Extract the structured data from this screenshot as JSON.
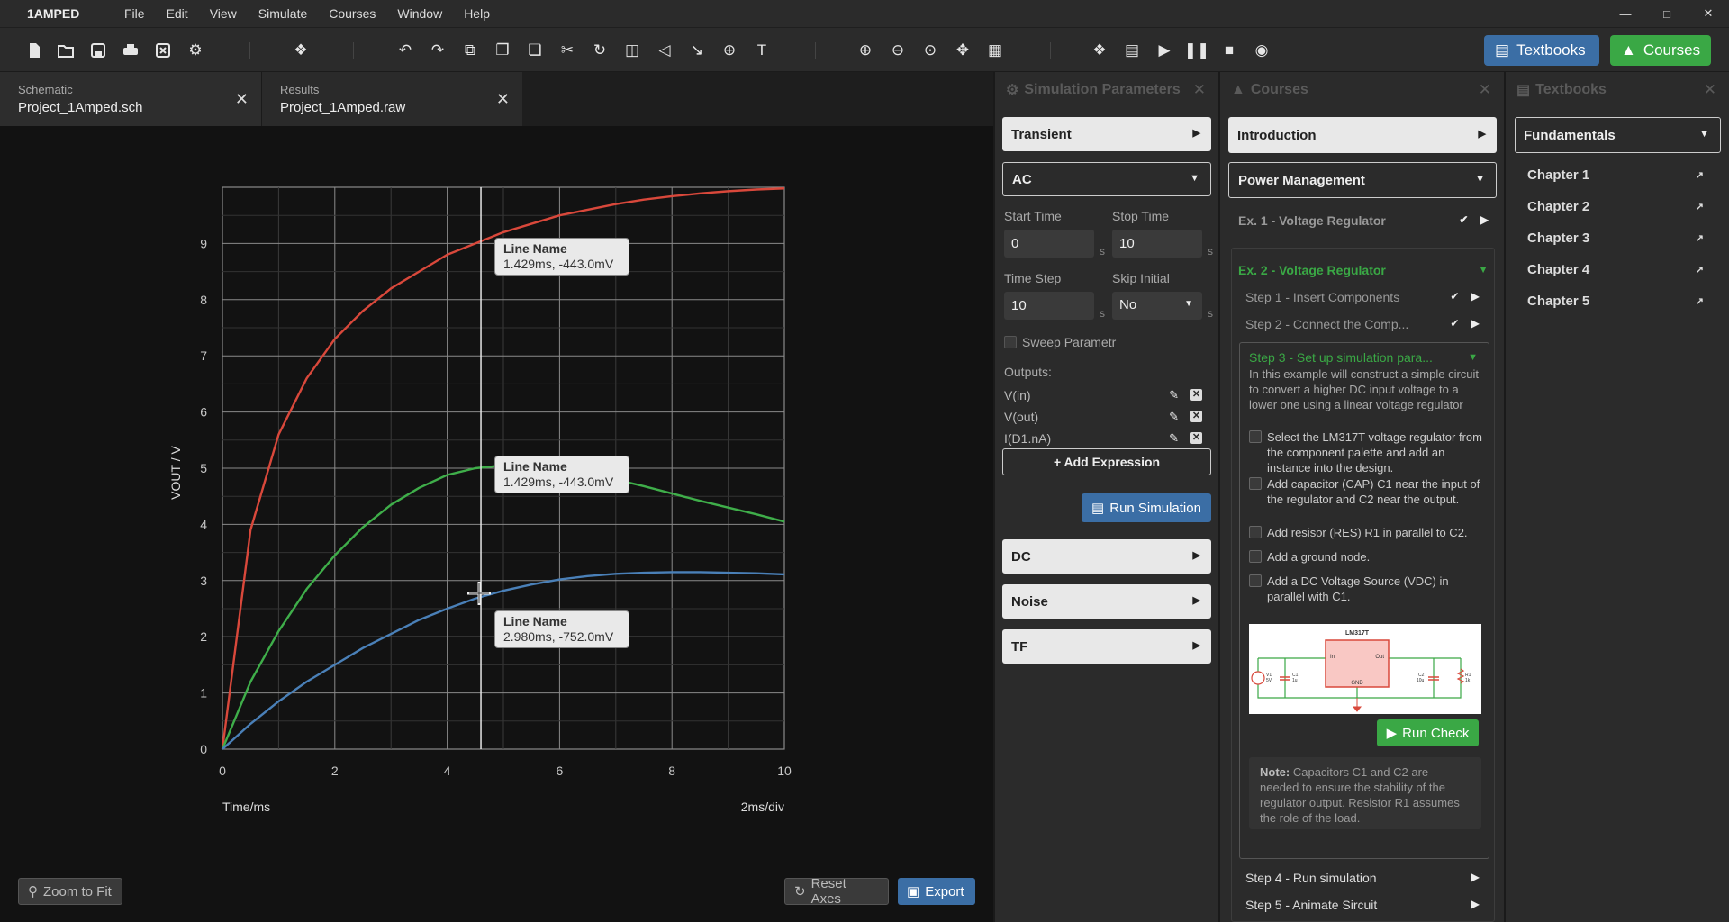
{
  "app": {
    "name": "1AMPED"
  },
  "menu": [
    "File",
    "Edit",
    "View",
    "Simulate",
    "Courses",
    "Window",
    "Help"
  ],
  "toolbar": {
    "textbooks_label": "Textbooks",
    "courses_label": "Courses"
  },
  "tabs": [
    {
      "type": "Schematic",
      "file": "Project_1Amped.sch"
    },
    {
      "type": "Results",
      "file": "Project_1Amped.raw"
    }
  ],
  "chart": {
    "xlabel": "Time/ms",
    "ylabel": "VOUT / V",
    "div_label": "2ms/div",
    "tooltips": [
      {
        "title": "Line Name",
        "value": "1.429ms, -443.0mV"
      },
      {
        "title": "Line Name",
        "value": "1.429ms, -443.0mV"
      },
      {
        "title": "Line Name",
        "value": "2.980ms, -752.0mV"
      }
    ],
    "zoom_fit_label": "Zoom to Fit",
    "reset_axes_label": "Reset Axes",
    "export_label": "Export"
  },
  "chart_data": {
    "type": "line",
    "xlim": [
      0,
      10
    ],
    "ylim": [
      0,
      10
    ],
    "xticks": [
      0,
      2,
      4,
      6,
      8,
      10
    ],
    "yticks": [
      0,
      1,
      2,
      3,
      4,
      5,
      6,
      7,
      8,
      9
    ],
    "grid": true,
    "cursor_x": 4.6,
    "x": [
      0,
      0.5,
      1,
      1.5,
      2,
      2.5,
      3,
      3.5,
      4,
      4.5,
      5,
      5.5,
      6,
      6.5,
      7,
      7.5,
      8,
      8.5,
      9,
      9.5,
      10
    ],
    "series": [
      {
        "color": "#d9483b",
        "values": [
          0,
          3.9,
          5.6,
          6.6,
          7.3,
          7.8,
          8.2,
          8.5,
          8.8,
          9.0,
          9.2,
          9.35,
          9.5,
          9.6,
          9.7,
          9.78,
          9.84,
          9.89,
          9.93,
          9.96,
          9.98
        ]
      },
      {
        "color": "#3fae4a",
        "values": [
          0,
          1.2,
          2.1,
          2.85,
          3.45,
          3.95,
          4.35,
          4.65,
          4.88,
          5.0,
          5.05,
          5.03,
          4.98,
          4.9,
          4.8,
          4.68,
          4.55,
          4.42,
          4.3,
          4.18,
          4.05
        ]
      },
      {
        "color": "#4a80b8",
        "values": [
          0,
          0.45,
          0.85,
          1.2,
          1.5,
          1.8,
          2.05,
          2.3,
          2.5,
          2.68,
          2.82,
          2.93,
          3.02,
          3.08,
          3.12,
          3.14,
          3.15,
          3.15,
          3.14,
          3.13,
          3.11
        ]
      }
    ]
  },
  "sim": {
    "title": "Simulation Parameters",
    "transient": "Transient",
    "ac": "AC",
    "start_time_label": "Start Time",
    "start_time": "0",
    "stop_time_label": "Stop Time",
    "stop_time": "10",
    "time_step_label": "Time Step",
    "time_step": "10",
    "skip_initial_label": "Skip Initial",
    "skip_initial": "No",
    "unit": "s",
    "sweep_label": "Sweep Parametr",
    "outputs_label": "Outputs:",
    "outputs": [
      "V(in)",
      "V(out)",
      "I(D1.nA)"
    ],
    "add_expression": "+ Add Expression",
    "run_simulation": "Run Simulation",
    "dc": "DC",
    "noise": "Noise",
    "tf": "TF"
  },
  "courses": {
    "title": "Courses",
    "introduction": "Introduction",
    "power_management": "Power Management",
    "ex1": "Ex. 1 - Voltage Regulator",
    "ex2": "Ex. 2 - Voltage Regulator",
    "step1": "Step 1 - Insert Components",
    "step2": "Step 2 - Connect the Comp...",
    "step3": "Step 3 - Set up simulation para...",
    "step3_desc": "In this example will construct a simple circuit to convert a higher DC input voltage to a lower one using a linear voltage regulator",
    "tasks": [
      "Select the LM317T voltage regulator from the component palette and add an instance into the design.",
      "Add capacitor (CAP) C1 near the input of the regulator and C2 near the output.",
      "Add resisor (RES) R1 in parallel to C2.",
      "Add a ground node.",
      "Add a DC Voltage Source (VDC) in parallel with C1."
    ],
    "circuit": {
      "chip": "LM317T",
      "in": "In",
      "out": "Out",
      "gnd": "GND",
      "v1": "V1",
      "v1_val": "5V",
      "c1": "C1",
      "c1_val": "1u",
      "c2": "C2",
      "c2_val": "10u",
      "r1": "R1",
      "r1_val": "1k"
    },
    "run_check": "Run Check",
    "note_label": "Note:",
    "note_text": "Capacitors C1 and C2 are needed to ensure the stability of the regulator output. Resistor R1 assumes the role of the load.",
    "step4": "Step 4 - Run simulation",
    "step5": "Step 5 - Animate Sircuit"
  },
  "textbooks": {
    "title": "Textbooks",
    "fundamentals": "Fundamentals",
    "chapters": [
      "Chapter 1",
      "Chapter 2",
      "Chapter 3",
      "Chapter 4",
      "Chapter 5"
    ]
  }
}
